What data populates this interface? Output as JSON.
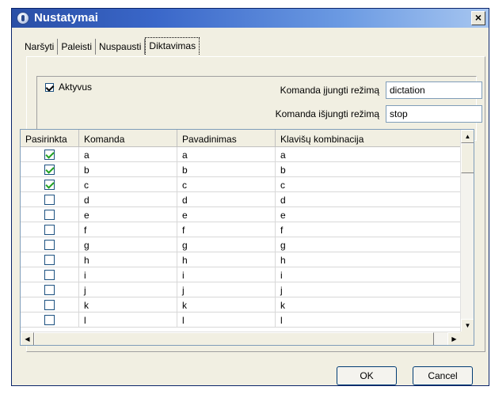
{
  "window": {
    "title": "Nustatymai",
    "close_label": "×"
  },
  "tabs": [
    {
      "label": "Naršyti"
    },
    {
      "label": "Paleisti"
    },
    {
      "label": "Nuspausti"
    },
    {
      "label": "Diktavimas"
    }
  ],
  "options": {
    "aktyvus_label": "Aktyvus",
    "aktyvus_checked": true,
    "on_label": "Komanda įjungti režimą",
    "on_value": "dictation",
    "off_label": "Komanda išjungti režimą",
    "off_value": "stop"
  },
  "grid": {
    "headers": [
      "Pasirinkta",
      "Komanda",
      "Pavadinimas",
      "Klavišų kombinacija"
    ],
    "rows": [
      {
        "checked": true,
        "komanda": "a",
        "pavadinimas": "a",
        "klavisai": "a"
      },
      {
        "checked": true,
        "komanda": "b",
        "pavadinimas": "b",
        "klavisai": "b"
      },
      {
        "checked": true,
        "komanda": "c",
        "pavadinimas": "c",
        "klavisai": "c"
      },
      {
        "checked": false,
        "komanda": "d",
        "pavadinimas": "d",
        "klavisai": "d"
      },
      {
        "checked": false,
        "komanda": "e",
        "pavadinimas": "e",
        "klavisai": "e"
      },
      {
        "checked": false,
        "komanda": "f",
        "pavadinimas": "f",
        "klavisai": "f"
      },
      {
        "checked": false,
        "komanda": "g",
        "pavadinimas": "g",
        "klavisai": "g"
      },
      {
        "checked": false,
        "komanda": "h",
        "pavadinimas": "h",
        "klavisai": "h"
      },
      {
        "checked": false,
        "komanda": "i",
        "pavadinimas": "i",
        "klavisai": "i"
      },
      {
        "checked": false,
        "komanda": "j",
        "pavadinimas": "j",
        "klavisai": "j"
      },
      {
        "checked": false,
        "komanda": "k",
        "pavadinimas": "k",
        "klavisai": "k"
      },
      {
        "checked": false,
        "komanda": "l",
        "pavadinimas": "l",
        "klavisai": "l"
      }
    ]
  },
  "buttons": {
    "ok": "OK",
    "cancel": "Cancel"
  }
}
